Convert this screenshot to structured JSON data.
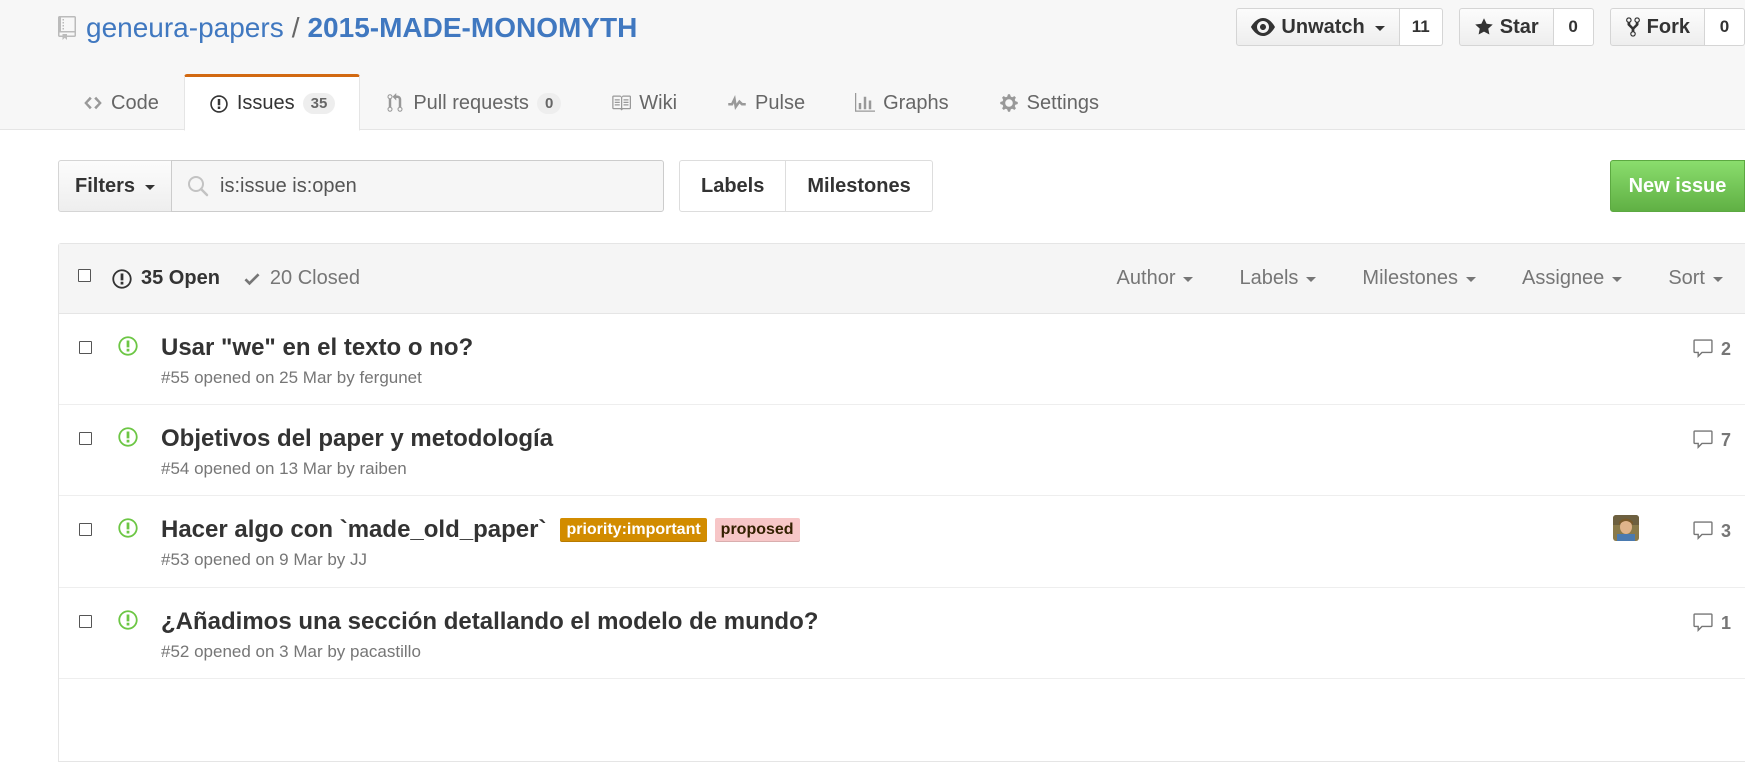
{
  "repo": {
    "owner": "geneura-papers",
    "separator": "/",
    "name": "2015-MADE-MONOMYTH"
  },
  "actions": {
    "watch": {
      "label": "Unwatch",
      "count": "11"
    },
    "star": {
      "label": "Star",
      "count": "0"
    },
    "fork": {
      "label": "Fork",
      "count": "0"
    }
  },
  "nav": {
    "code": "Code",
    "issues": "Issues",
    "issues_count": "35",
    "pulls": "Pull requests",
    "pulls_count": "0",
    "wiki": "Wiki",
    "pulse": "Pulse",
    "graphs": "Graphs",
    "settings": "Settings"
  },
  "subnav": {
    "filters": "Filters",
    "search_value": "is:issue is:open",
    "labels": "Labels",
    "milestones": "Milestones",
    "new_issue": "New issue"
  },
  "table": {
    "open": "35 Open",
    "closed": "20 Closed",
    "filters": {
      "author": "Author",
      "labels": "Labels",
      "milestones": "Milestones",
      "assignee": "Assignee",
      "sort": "Sort"
    }
  },
  "colors": {
    "open_icon": "#6cc644",
    "label_priority_bg": "#d28c00",
    "label_proposed_bg": "#f7c6c7",
    "label_proposed_fg": "#332000"
  },
  "issues": [
    {
      "title": "Usar \"we\" en el texto o no?",
      "meta": "#55 opened on 25 Mar by fergunet",
      "comments": "2"
    },
    {
      "title": "Objetivos del paper y metodología",
      "meta": "#54 opened on 13 Mar by raiben",
      "comments": "7"
    },
    {
      "title": "Hacer algo con `made_old_paper`",
      "meta": "#53 opened on 9 Mar by JJ",
      "comments": "3",
      "labels": [
        "priority:important",
        "proposed"
      ]
    },
    {
      "title": "¿Añadimos una sección detallando el modelo de mundo?",
      "meta": "#52 opened on 3 Mar by pacastillo",
      "comments": "1"
    }
  ]
}
